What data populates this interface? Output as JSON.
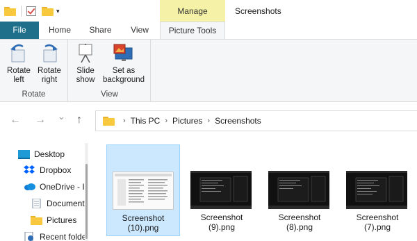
{
  "qat": {
    "icons": [
      "folder-icon",
      "properties-check-icon",
      "new-folder-icon",
      "customize-dropdown-icon"
    ]
  },
  "context_tab": {
    "label": "Manage"
  },
  "window": {
    "title": "Screenshots"
  },
  "tabs": [
    {
      "label": "File"
    },
    {
      "label": "Home"
    },
    {
      "label": "Share"
    },
    {
      "label": "View"
    },
    {
      "label": "Picture Tools"
    }
  ],
  "ribbon": {
    "groups": [
      {
        "label": "Rotate",
        "buttons": [
          {
            "line1": "Rotate",
            "line2": "left",
            "icon": "rotate-left-icon"
          },
          {
            "line1": "Rotate",
            "line2": "right",
            "icon": "rotate-right-icon"
          }
        ]
      },
      {
        "label": "View",
        "buttons": [
          {
            "line1": "Slide",
            "line2": "show",
            "icon": "slideshow-icon"
          },
          {
            "line1": "Set as",
            "line2": "background",
            "icon": "set-background-icon"
          }
        ]
      }
    ]
  },
  "nav": {
    "back_icon": "←",
    "forward_icon": "→",
    "recent_icon": "⌄",
    "up_icon": "↑",
    "breadcrumb": [
      "This PC",
      "Pictures",
      "Screenshots"
    ],
    "separator": "›"
  },
  "sidebar": {
    "items": [
      {
        "label": "Desktop",
        "icon": "desktop-icon"
      },
      {
        "label": "Dropbox",
        "icon": "dropbox-icon"
      },
      {
        "label": "OneDrive - I",
        "icon": "onedrive-icon"
      },
      {
        "label": "Document",
        "icon": "documents-icon"
      },
      {
        "label": "Pictures",
        "icon": "pictures-folder-icon"
      },
      {
        "label": "Recent folde",
        "icon": "recent-folders-icon"
      }
    ]
  },
  "files": [
    {
      "line1": "Screenshot",
      "line2": "(10).png",
      "selected": true
    },
    {
      "line1": "Screenshot",
      "line2": "(9).png",
      "selected": false
    },
    {
      "line1": "Screenshot",
      "line2": "(8).png",
      "selected": false
    },
    {
      "line1": "Screenshot",
      "line2": "(7).png",
      "selected": false
    }
  ],
  "colors": {
    "file_tab": "#1f6f8b",
    "manage_tab": "#f5f1a6",
    "selection": "#cce8ff",
    "folder": "#f8c93e"
  }
}
